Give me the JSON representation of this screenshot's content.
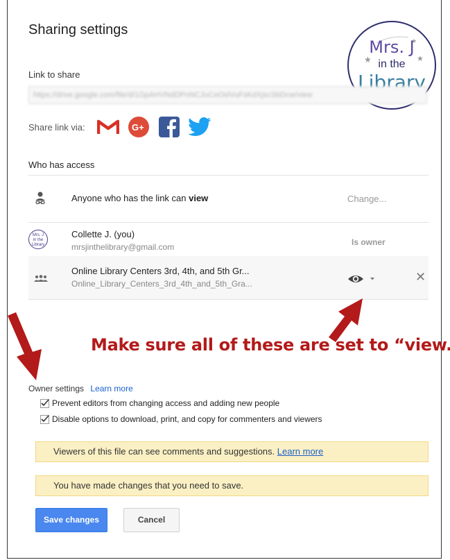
{
  "dialog": {
    "title": "Sharing settings",
    "link_label": "Link to share",
    "link_value": "https://drive.google.com/file/d/1GpAHVNdDPnNCJuCeOslVuFsKdXjscSbDcw/view",
    "share_via_label": "Share link via:",
    "share_services": [
      "gmail-icon",
      "google-plus-icon",
      "facebook-icon",
      "twitter-icon"
    ],
    "who_has_access_label": "Who has access"
  },
  "access_list": [
    {
      "text_prefix": "Anyone who has the link can ",
      "text_bold": "view",
      "action": "Change...",
      "icon": "link-person-icon"
    },
    {
      "name": "Collette J. (you)",
      "email": "mrsjinthelibrary@gmail.com",
      "role": "Is owner",
      "icon": "avatar"
    },
    {
      "name": "Online Library Centers 3rd, 4th, and 5th Gr...",
      "detail": "Online_Library_Centers_3rd_4th_and_5th_Gra...",
      "permission_icon": "eye-icon",
      "icon": "group-icon"
    }
  ],
  "logo": {
    "line1": "Mrs. J",
    "line2": "in the",
    "line3": "Library"
  },
  "avatar": {
    "line1": "Mrs. J",
    "line2": "in the",
    "line3": "Library"
  },
  "annotation": {
    "text": "Make sure all of these are set to “view.”",
    "color": "#b31a1a"
  },
  "owner_settings": {
    "label": "Owner settings",
    "learn_more": "Learn more",
    "options": [
      {
        "label": "Prevent editors from changing access and adding new people",
        "checked": true
      },
      {
        "label": "Disable options to download, print, and copy for commenters and viewers",
        "checked": true
      }
    ]
  },
  "notices": {
    "viewers_text": "Viewers of this file can see comments and suggestions. ",
    "viewers_link": "Learn more",
    "unsaved_text": "You have made changes that you need to save."
  },
  "buttons": {
    "save": "Save changes",
    "cancel": "Cancel"
  },
  "colors": {
    "accent": "#4a87ee",
    "notice_bg": "#fbf0c4",
    "arrow": "#b31a1a"
  }
}
